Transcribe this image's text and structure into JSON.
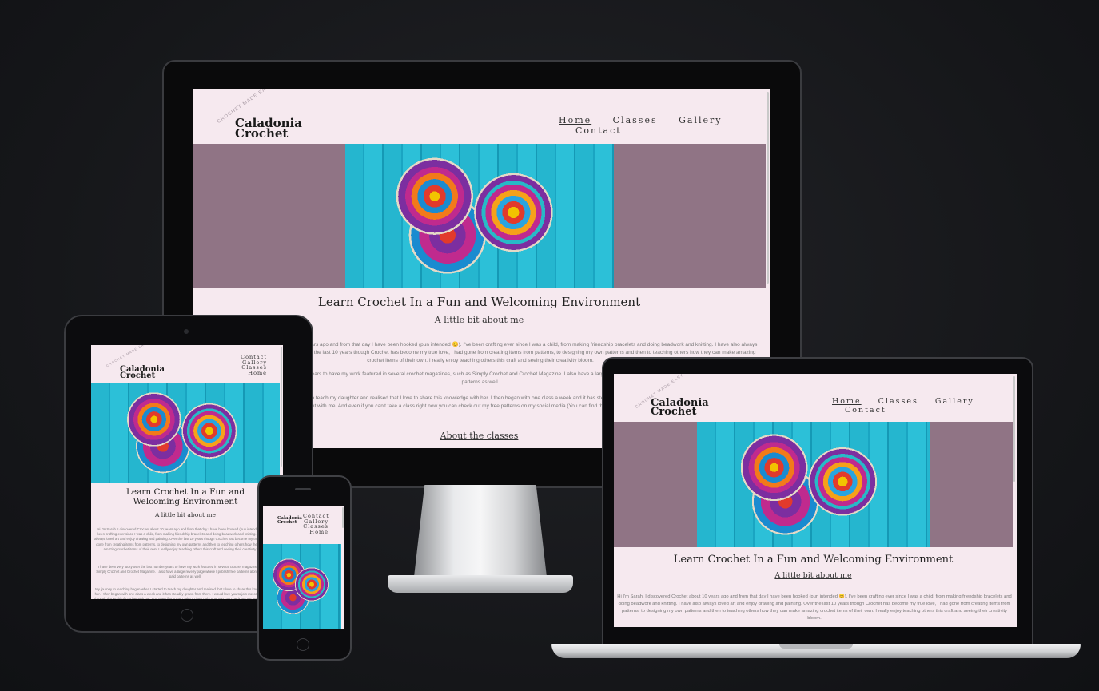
{
  "brand": {
    "arc": "CROCHET MADE EASY",
    "line1": "Caladonia",
    "line2": "Crochet"
  },
  "nav": {
    "home": "Home",
    "classes": "Classes",
    "gallery": "Gallery",
    "contact": "Contact"
  },
  "hero": {
    "image": "crochet-mandala-hoops"
  },
  "main": {
    "title": "Learn Crochet In a Fun and Welcoming Environment",
    "about_link": "A little bit about me",
    "p1": "Hi I'm Sarah. I discovered Crochet about 10 years ago and from that day I have been hooked (pun intended 😊). I've been crafting ever since I was a child, from making friendship bracelets and doing beadwork and knitting. I have also always loved art and enjoy drawing and painting. Over the last 10 years though Crochet has become my true love, I had gone from creating items from patterns, to designing my own patterns and then to teaching others how they can make amazing crochet items of their own. I really enjoy teaching others this craft and seeing their creativity bloom.",
    "p2": "I have been very lucky over the last number years to have my work featured in several crochet magazines, such as Simply Crochet and Crochet Magazine. I also have a large revelry page where I publish free patterns along with some paid patterns as well.",
    "p3": "My journey to teaching began when I started to teach my daughter and realised that I love to share this knowledge with her. I then began with one class a week and it has steadily grown from there. I would love you to join me on this journey through the world of crochet with me. And even if you can't take a class right now you can check out my free patterns on my social media (You can find the links to my pages at the bottom of this page)",
    "classes_link": "About the classes"
  },
  "colors": {
    "background": "#151619",
    "site_bg": "#f6e9ef",
    "hero_band": "#907485"
  }
}
